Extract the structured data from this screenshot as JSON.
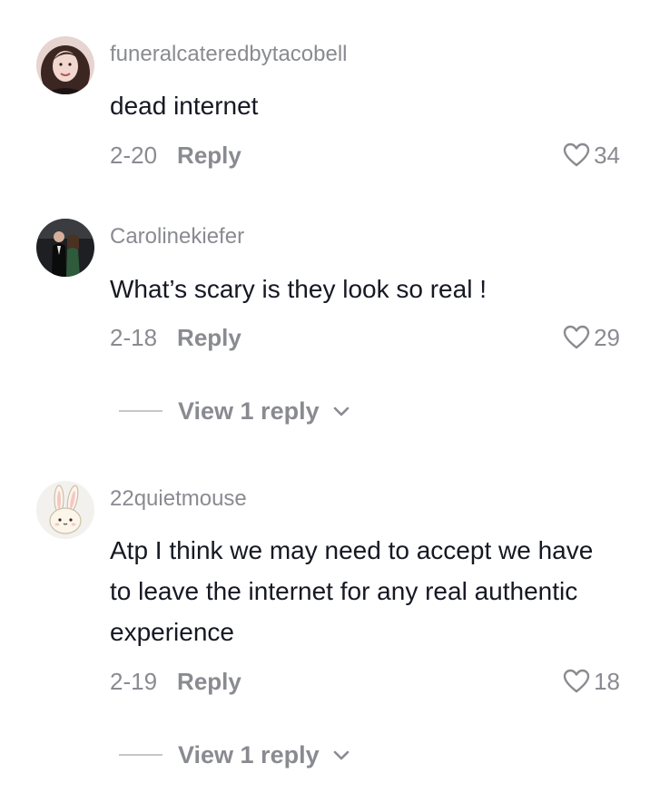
{
  "comments": [
    {
      "username": "funeralcateredbytacobell",
      "avatar_icon": "woman-portrait-avatar",
      "text": "dead internet",
      "date": "2-20",
      "reply_label": "Reply",
      "likes": "34"
    },
    {
      "username": "Carolinekiefer",
      "avatar_icon": "couple-photo-avatar",
      "text": "What’s scary is they look so real !",
      "date": "2-18",
      "reply_label": "Reply",
      "likes": "29",
      "view_replies": "View 1 reply"
    },
    {
      "username": "22quietmouse",
      "avatar_icon": "bunny-avatar",
      "text": "Atp I think we may need to accept we have to leave the internet for any real authentic experience",
      "date": "2-19",
      "reply_label": "Reply",
      "likes": "18",
      "view_replies": "View 1 reply"
    }
  ],
  "colors": {
    "text_primary": "#161823",
    "text_secondary": "#8a8b91",
    "divider": "#c6c7cb"
  }
}
